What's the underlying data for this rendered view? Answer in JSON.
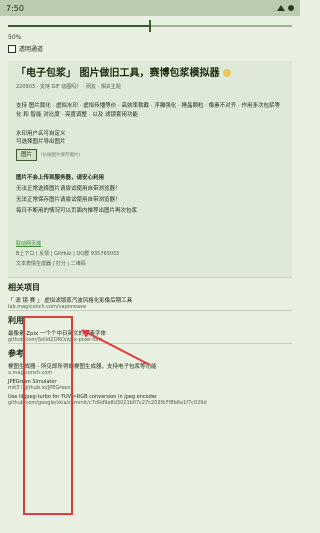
{
  "status_bar": {
    "time": "7:50",
    "icons": [
      "wifi-icon",
      "battery-icon"
    ]
  },
  "quality": {
    "label": "50%",
    "value_percent": 50
  },
  "keep_transparency": {
    "label": "透明通道"
  },
  "main_card": {
    "title": "「电子包浆」 图片做旧工具，赛博包浆模拟器",
    "meta_line": "220903 · 支持 GIF 动图吗！ · 网友 · 相关主题",
    "description": "支持 图片裁化 · 虚拟水印 · 虚拟传播等价 · 高效率裁截 · 浮雕强化 · 睡晶颗粒 · 像素不对齐 · 作用多次包浆等化 和 智能 对比度 · 亮度调整 · 以及 滤镜套用功能",
    "watermark_line1": "水印用户名可自定义",
    "watermark_line2": "可选择图片导出图片",
    "button_label": "图片",
    "button_hint": "(长按图片保存图片)",
    "notice_title": "图片不会上传到服务器，请安心利用",
    "notice_1": "无法正常选择图片请尝试使用自带浏览器！",
    "notice_2": "无法正常保存图片请尝试使用自带浏览器！",
    "notice_3": "每日不断用的情况可以页面内推荐出图片再次包浆",
    "links_title": "联动网页端",
    "links_row_1": "B上下口 | 反馈 | GitHub | QQ群 935765055",
    "links_row_2": "文本表情生成器 | 打分 | 二维码"
  },
  "related": {
    "title": "相关项目",
    "item_title": "「 滤 镜 赛 」 虚拟滤镜蒸汽波风格化影像后期工具",
    "item_url": "lab.magiconch.com/vaporwave"
  },
  "uses": {
    "title": "利用",
    "item_title": "最像素 Zpix 一个个中日英文的像素字体",
    "item_url": "github.com/SolidZORO/zpix-pixel-font"
  },
  "reference": {
    "title": "参考",
    "item_title": "梗图生成器 - 所见即所得的梗图生成器，支持电子包浆等功能",
    "item_url": "x.magiconch.com"
  },
  "jpeg": {
    "title": "JPEGreen Simulator",
    "url": "mit3 l.github.io/JPEGreen"
  },
  "libjpeg": {
    "text": "Use libjpeg-turbo for YUV->RGB conversion in jpeg encoder",
    "url": "github.com/google/skia/commit/c7d0d9e8d3021b07c27c203fb7f8b6e1f7c029d"
  },
  "colors": {
    "accent": "#3d5a30",
    "link": "#3c8a2e",
    "annotation": "#e23b3b"
  }
}
